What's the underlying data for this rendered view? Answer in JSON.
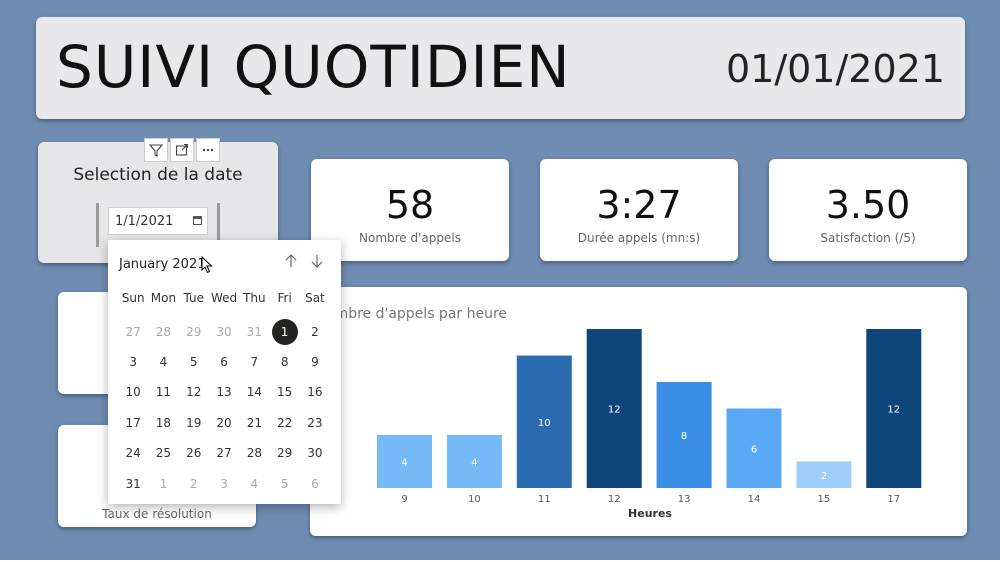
{
  "header": {
    "title": "SUIVI QUOTIDIEN",
    "date": "01/01/2021"
  },
  "slicer": {
    "title": "Selection de la date",
    "input_value": "1/1/2021",
    "toolbar": {
      "filter_icon": "filter-icon",
      "focus_icon": "focus-mode-icon",
      "more_icon": "more-options-icon"
    }
  },
  "kpis": [
    {
      "value": "58",
      "label": "Nombre d'appels"
    },
    {
      "value": "3:27",
      "label": "Durée appels (mn:s)"
    },
    {
      "value": "3.50",
      "label": "Satisfaction (/5)"
    }
  ],
  "side_cards": [
    {
      "label": ""
    },
    {
      "label": "Taux de résolution"
    }
  ],
  "calendar": {
    "month_label": "January 2021",
    "weekdays": [
      "Sun",
      "Mon",
      "Tue",
      "Wed",
      "Thu",
      "Fri",
      "Sat"
    ],
    "days": [
      {
        "d": "27",
        "o": true
      },
      {
        "d": "28",
        "o": true
      },
      {
        "d": "29",
        "o": true
      },
      {
        "d": "30",
        "o": true
      },
      {
        "d": "31",
        "o": true
      },
      {
        "d": "1",
        "s": true
      },
      {
        "d": "2"
      },
      {
        "d": "3"
      },
      {
        "d": "4"
      },
      {
        "d": "5"
      },
      {
        "d": "6"
      },
      {
        "d": "7"
      },
      {
        "d": "8"
      },
      {
        "d": "9"
      },
      {
        "d": "10"
      },
      {
        "d": "11"
      },
      {
        "d": "12"
      },
      {
        "d": "13"
      },
      {
        "d": "14"
      },
      {
        "d": "15"
      },
      {
        "d": "16"
      },
      {
        "d": "17"
      },
      {
        "d": "18"
      },
      {
        "d": "19"
      },
      {
        "d": "20"
      },
      {
        "d": "21"
      },
      {
        "d": "22"
      },
      {
        "d": "23"
      },
      {
        "d": "24"
      },
      {
        "d": "25"
      },
      {
        "d": "26"
      },
      {
        "d": "27"
      },
      {
        "d": "28"
      },
      {
        "d": "29"
      },
      {
        "d": "30"
      },
      {
        "d": "31"
      },
      {
        "d": "1",
        "o": true
      },
      {
        "d": "2",
        "o": true
      },
      {
        "d": "3",
        "o": true
      },
      {
        "d": "4",
        "o": true
      },
      {
        "d": "5",
        "o": true
      },
      {
        "d": "6",
        "o": true
      }
    ],
    "prev_icon": "arrow-up-icon",
    "next_icon": "arrow-down-icon"
  },
  "chart_data": {
    "type": "bar",
    "title": "ombre d'appels par heure",
    "xlabel": "Heures",
    "ylabel": "",
    "categories": [
      "9",
      "10",
      "11",
      "12",
      "13",
      "14",
      "15",
      "17"
    ],
    "values": [
      4,
      4,
      10,
      12,
      8,
      6,
      2,
      12
    ],
    "ylim": [
      0,
      12
    ],
    "colors": [
      "#75b9f7",
      "#75b9f7",
      "#2b6cb0",
      "#0e457a",
      "#3a8ee6",
      "#5aa9f7",
      "#9fcffb",
      "#0e457a"
    ],
    "grid": false,
    "legend": "none"
  },
  "colors": {
    "background": "#6f8db3",
    "card": "#ffffff",
    "title_card": "#e8e8ea",
    "selected_day": "#252423"
  }
}
